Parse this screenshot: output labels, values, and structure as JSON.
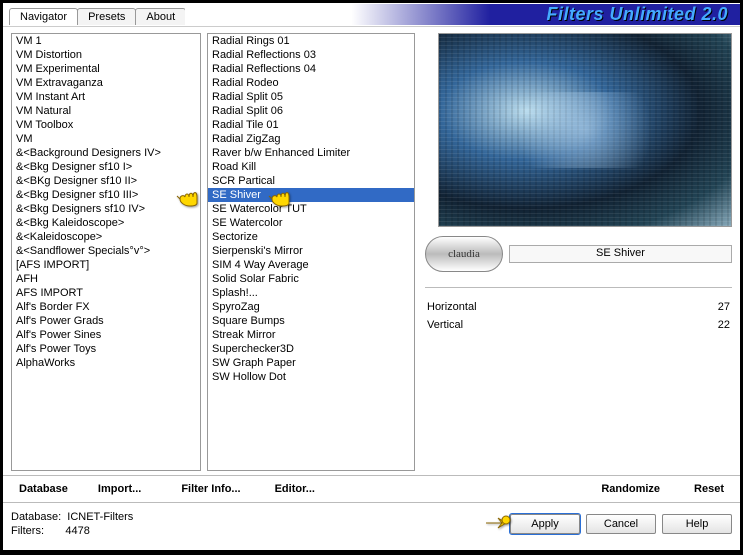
{
  "brand": "Filters Unlimited 2.0",
  "tabs": [
    "Navigator",
    "Presets",
    "About"
  ],
  "left_list": [
    "VM 1",
    "VM Distortion",
    "VM Experimental",
    "VM Extravaganza",
    "VM Instant Art",
    "VM Natural",
    "VM Toolbox",
    "VM",
    "&<Background Designers IV>",
    "&<Bkg Designer sf10 I>",
    "&<BKg Designer sf10 II>",
    "&<Bkg Designer sf10 III>",
    "&<Bkg Designers sf10 IV>",
    "&<Bkg Kaleidoscope>",
    "&<Kaleidoscope>",
    "&<Sandflower Specials°v°>",
    "[AFS IMPORT]",
    "AFH",
    "AFS IMPORT",
    "Alf's Border FX",
    "Alf's Power Grads",
    "Alf's Power Sines",
    "Alf's Power Toys",
    "AlphaWorks"
  ],
  "right_list": [
    "Radial  Rings 01",
    "Radial Reflections 03",
    "Radial Reflections 04",
    "Radial Rodeo",
    "Radial Split 05",
    "Radial Split 06",
    "Radial Tile 01",
    "Radial ZigZag",
    "Raver b/w Enhanced Limiter",
    "Road Kill",
    "SCR  Partical",
    "SE Shiver",
    "SE Watercolor TUT",
    "SE Watercolor",
    "Sectorize",
    "Sierpenski's Mirror",
    "SIM 4 Way Average",
    "Solid Solar Fabric",
    "Splash!...",
    "SpyroZag",
    "Square Bumps",
    "Streak Mirror",
    "Superchecker3D",
    "SW Graph Paper",
    "SW Hollow Dot"
  ],
  "right_selected": "SE Shiver",
  "claudia": "claudia",
  "filter_title": "SE Shiver",
  "sliders": [
    {
      "label": "Horizontal",
      "value": "27"
    },
    {
      "label": "Vertical",
      "value": "22"
    }
  ],
  "row_buttons": {
    "database": "Database",
    "import": "Import...",
    "filter_info": "Filter Info...",
    "editor": "Editor...",
    "randomize": "Randomize",
    "reset": "Reset"
  },
  "status": {
    "db_label": "Database:",
    "db_value": "ICNET-Filters",
    "filters_label": "Filters:",
    "filters_value": "4478"
  },
  "dialog_buttons": {
    "apply": "Apply",
    "cancel": "Cancel",
    "help": "Help"
  }
}
